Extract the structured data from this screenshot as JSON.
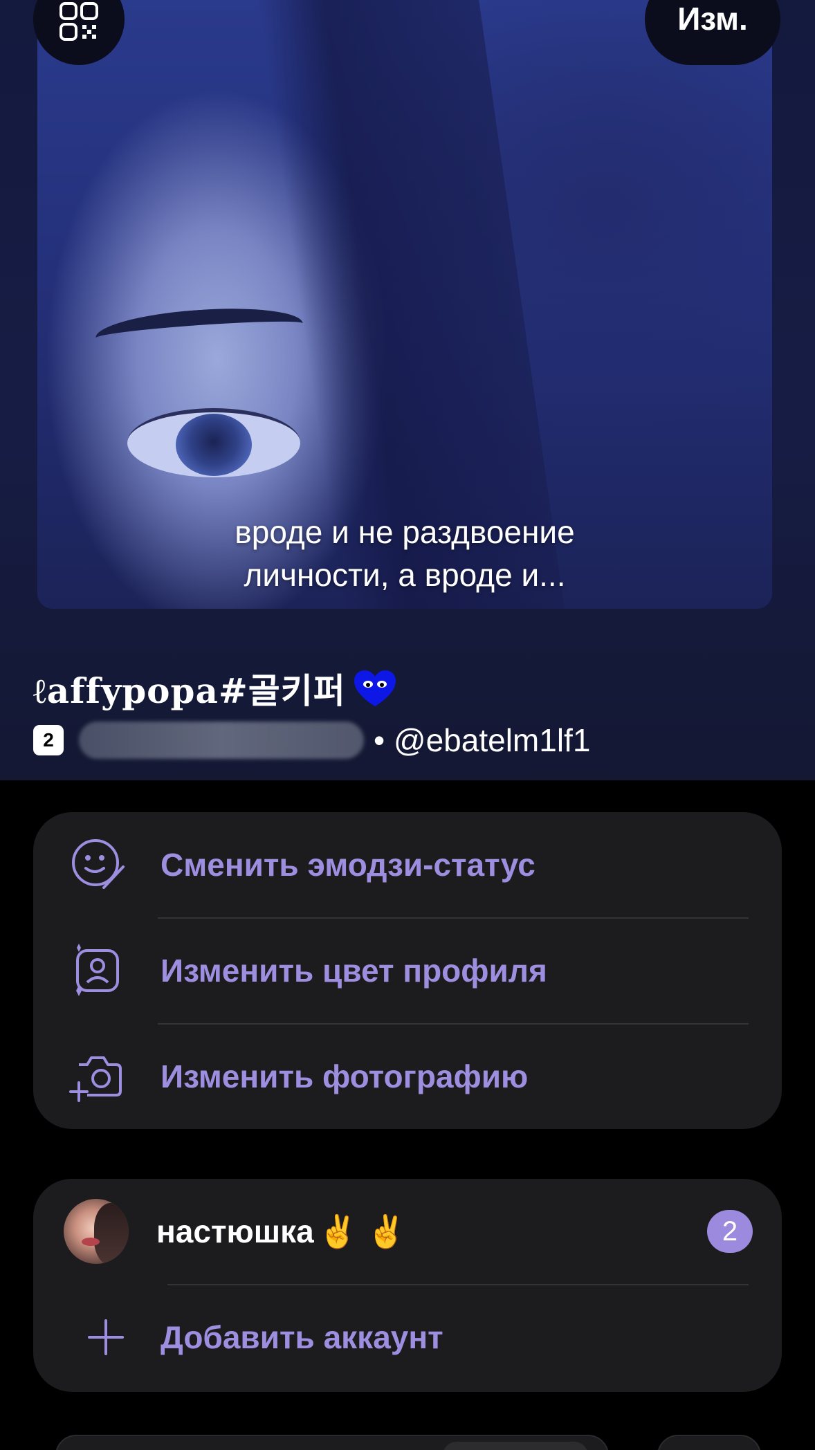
{
  "header": {
    "edit_label": "Изм.",
    "photo_caption_line1": "вроде и не раздвоение",
    "photo_caption_line2": "личности, а вроде и...",
    "profile_name": "ℓaffyрора#골키퍼",
    "badge_count": "2",
    "username": "• @ebatelm1lf1"
  },
  "menu": {
    "items": [
      {
        "label": "Сменить эмодзи-статус",
        "icon": "emoji-status-icon"
      },
      {
        "label": "Изменить цвет профиля",
        "icon": "profile-color-icon"
      },
      {
        "label": "Изменить фотографию",
        "icon": "camera-add-icon"
      }
    ]
  },
  "accounts": {
    "items": [
      {
        "name": "настюшка",
        "emoji": "✌️ ✌️",
        "unread": "2"
      }
    ],
    "add_label": "Добавить аккаунт"
  },
  "colors": {
    "accent": "#9d8ee0",
    "card_bg": "#1c1c1e",
    "badge": "#9b8add"
  }
}
